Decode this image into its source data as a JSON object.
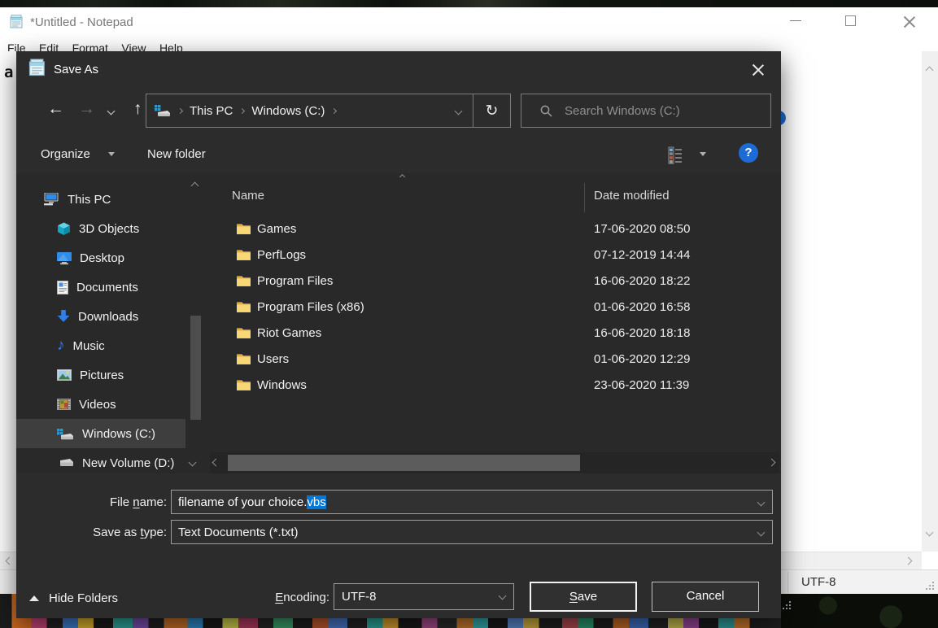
{
  "colors": {
    "dialog_bg": "#2c2c2c",
    "selection_blue": "#0078d7",
    "help_blue": "#1e6bd7",
    "folder_yellow": "#f7d878"
  },
  "icons": {
    "refresh_glyph": "↻",
    "back_glyph": "←",
    "forward_glyph": "→",
    "up_glyph": "↑",
    "help_glyph": "?",
    "music_glyph": "♪"
  },
  "notepad": {
    "window_title": "*Untitled - Notepad",
    "menu_items": [
      "File",
      "Edit",
      "Format",
      "View",
      "Help"
    ],
    "editor_text": "a",
    "status_encoding": "UTF-8"
  },
  "dialog": {
    "title": "Save As",
    "nav": {
      "breadcrumb_items": [
        "This PC",
        "Windows (C:)"
      ],
      "search_placeholder": "Search Windows (C:)"
    },
    "toolbar": {
      "organize_label": "Organize",
      "new_folder_label": "New folder"
    },
    "sidebar": {
      "items": [
        {
          "label": "This PC",
          "icon": "computer-icon"
        },
        {
          "label": "3D Objects",
          "icon": "cube-3d-icon"
        },
        {
          "label": "Desktop",
          "icon": "desktop-icon"
        },
        {
          "label": "Documents",
          "icon": "document-icon"
        },
        {
          "label": "Downloads",
          "icon": "download-arrow-icon"
        },
        {
          "label": "Music",
          "icon": "music-note-icon"
        },
        {
          "label": "Pictures",
          "icon": "picture-icon"
        },
        {
          "label": "Videos",
          "icon": "video-film-icon"
        },
        {
          "label": "Windows (C:)",
          "icon": "windows-drive-icon",
          "selected": true
        },
        {
          "label": "New Volume (D:)",
          "icon": "drive-icon"
        }
      ]
    },
    "file_list": {
      "columns": [
        "Name",
        "Date modified"
      ],
      "rows": [
        {
          "name": "Games",
          "date_modified": "17-06-2020 08:50"
        },
        {
          "name": "PerfLogs",
          "date_modified": "07-12-2019 14:44"
        },
        {
          "name": "Program Files",
          "date_modified": "16-06-2020 18:22"
        },
        {
          "name": "Program Files (x86)",
          "date_modified": "01-06-2020 16:58"
        },
        {
          "name": "Riot Games",
          "date_modified": "16-06-2020 18:18"
        },
        {
          "name": "Users",
          "date_modified": "01-06-2020 12:29"
        },
        {
          "name": "Windows",
          "date_modified": "23-06-2020 11:39"
        }
      ]
    },
    "file_name_field": {
      "label_pre": "File ",
      "label_key": "n",
      "label_post": "ame:",
      "value_before_selection": "filename of your choice.",
      "value_selected": "vbs"
    },
    "save_as_type_field": {
      "label_pre": "Save as ",
      "label_key": "t",
      "label_post": "ype:",
      "value": "Text Documents (*.txt)"
    },
    "footer": {
      "hide_folders_label": "Hide Folders",
      "encoding_label_key": "E",
      "encoding_label_post": "ncoding:",
      "encoding_value": "UTF-8",
      "save_label_key": "S",
      "save_label_post": "ave",
      "cancel_label": "Cancel"
    }
  }
}
